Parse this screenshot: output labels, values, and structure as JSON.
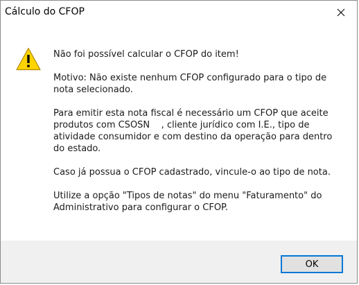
{
  "window": {
    "title": "Cálculo do CFOP"
  },
  "message": {
    "paragraphs": [
      "Não foi possível calcular o CFOP do item!",
      "Motivo: Não existe nenhum CFOP configurado para o tipo de nota selecionado.",
      "Para emitir esta nota fiscal é necessário um CFOP que aceite produtos com CSOSN    , cliente jurídico com I.E., tipo de atividade consumidor e com destino da operação para dentro do estado.",
      "Caso já possua o CFOP cadastrado, vincule-o ao tipo de nota.",
      "Utilize a opção \"Tipos de notas\" do menu \"Faturamento\" do Administrativo para configurar o CFOP."
    ]
  },
  "buttons": {
    "ok_label": "OK"
  },
  "icons": {
    "close": "close-icon",
    "warning": "warning-icon"
  },
  "colors": {
    "warning_fill": "#FFD400",
    "button_focus_border": "#0078D7",
    "footer_bg": "#F0F0F0"
  }
}
